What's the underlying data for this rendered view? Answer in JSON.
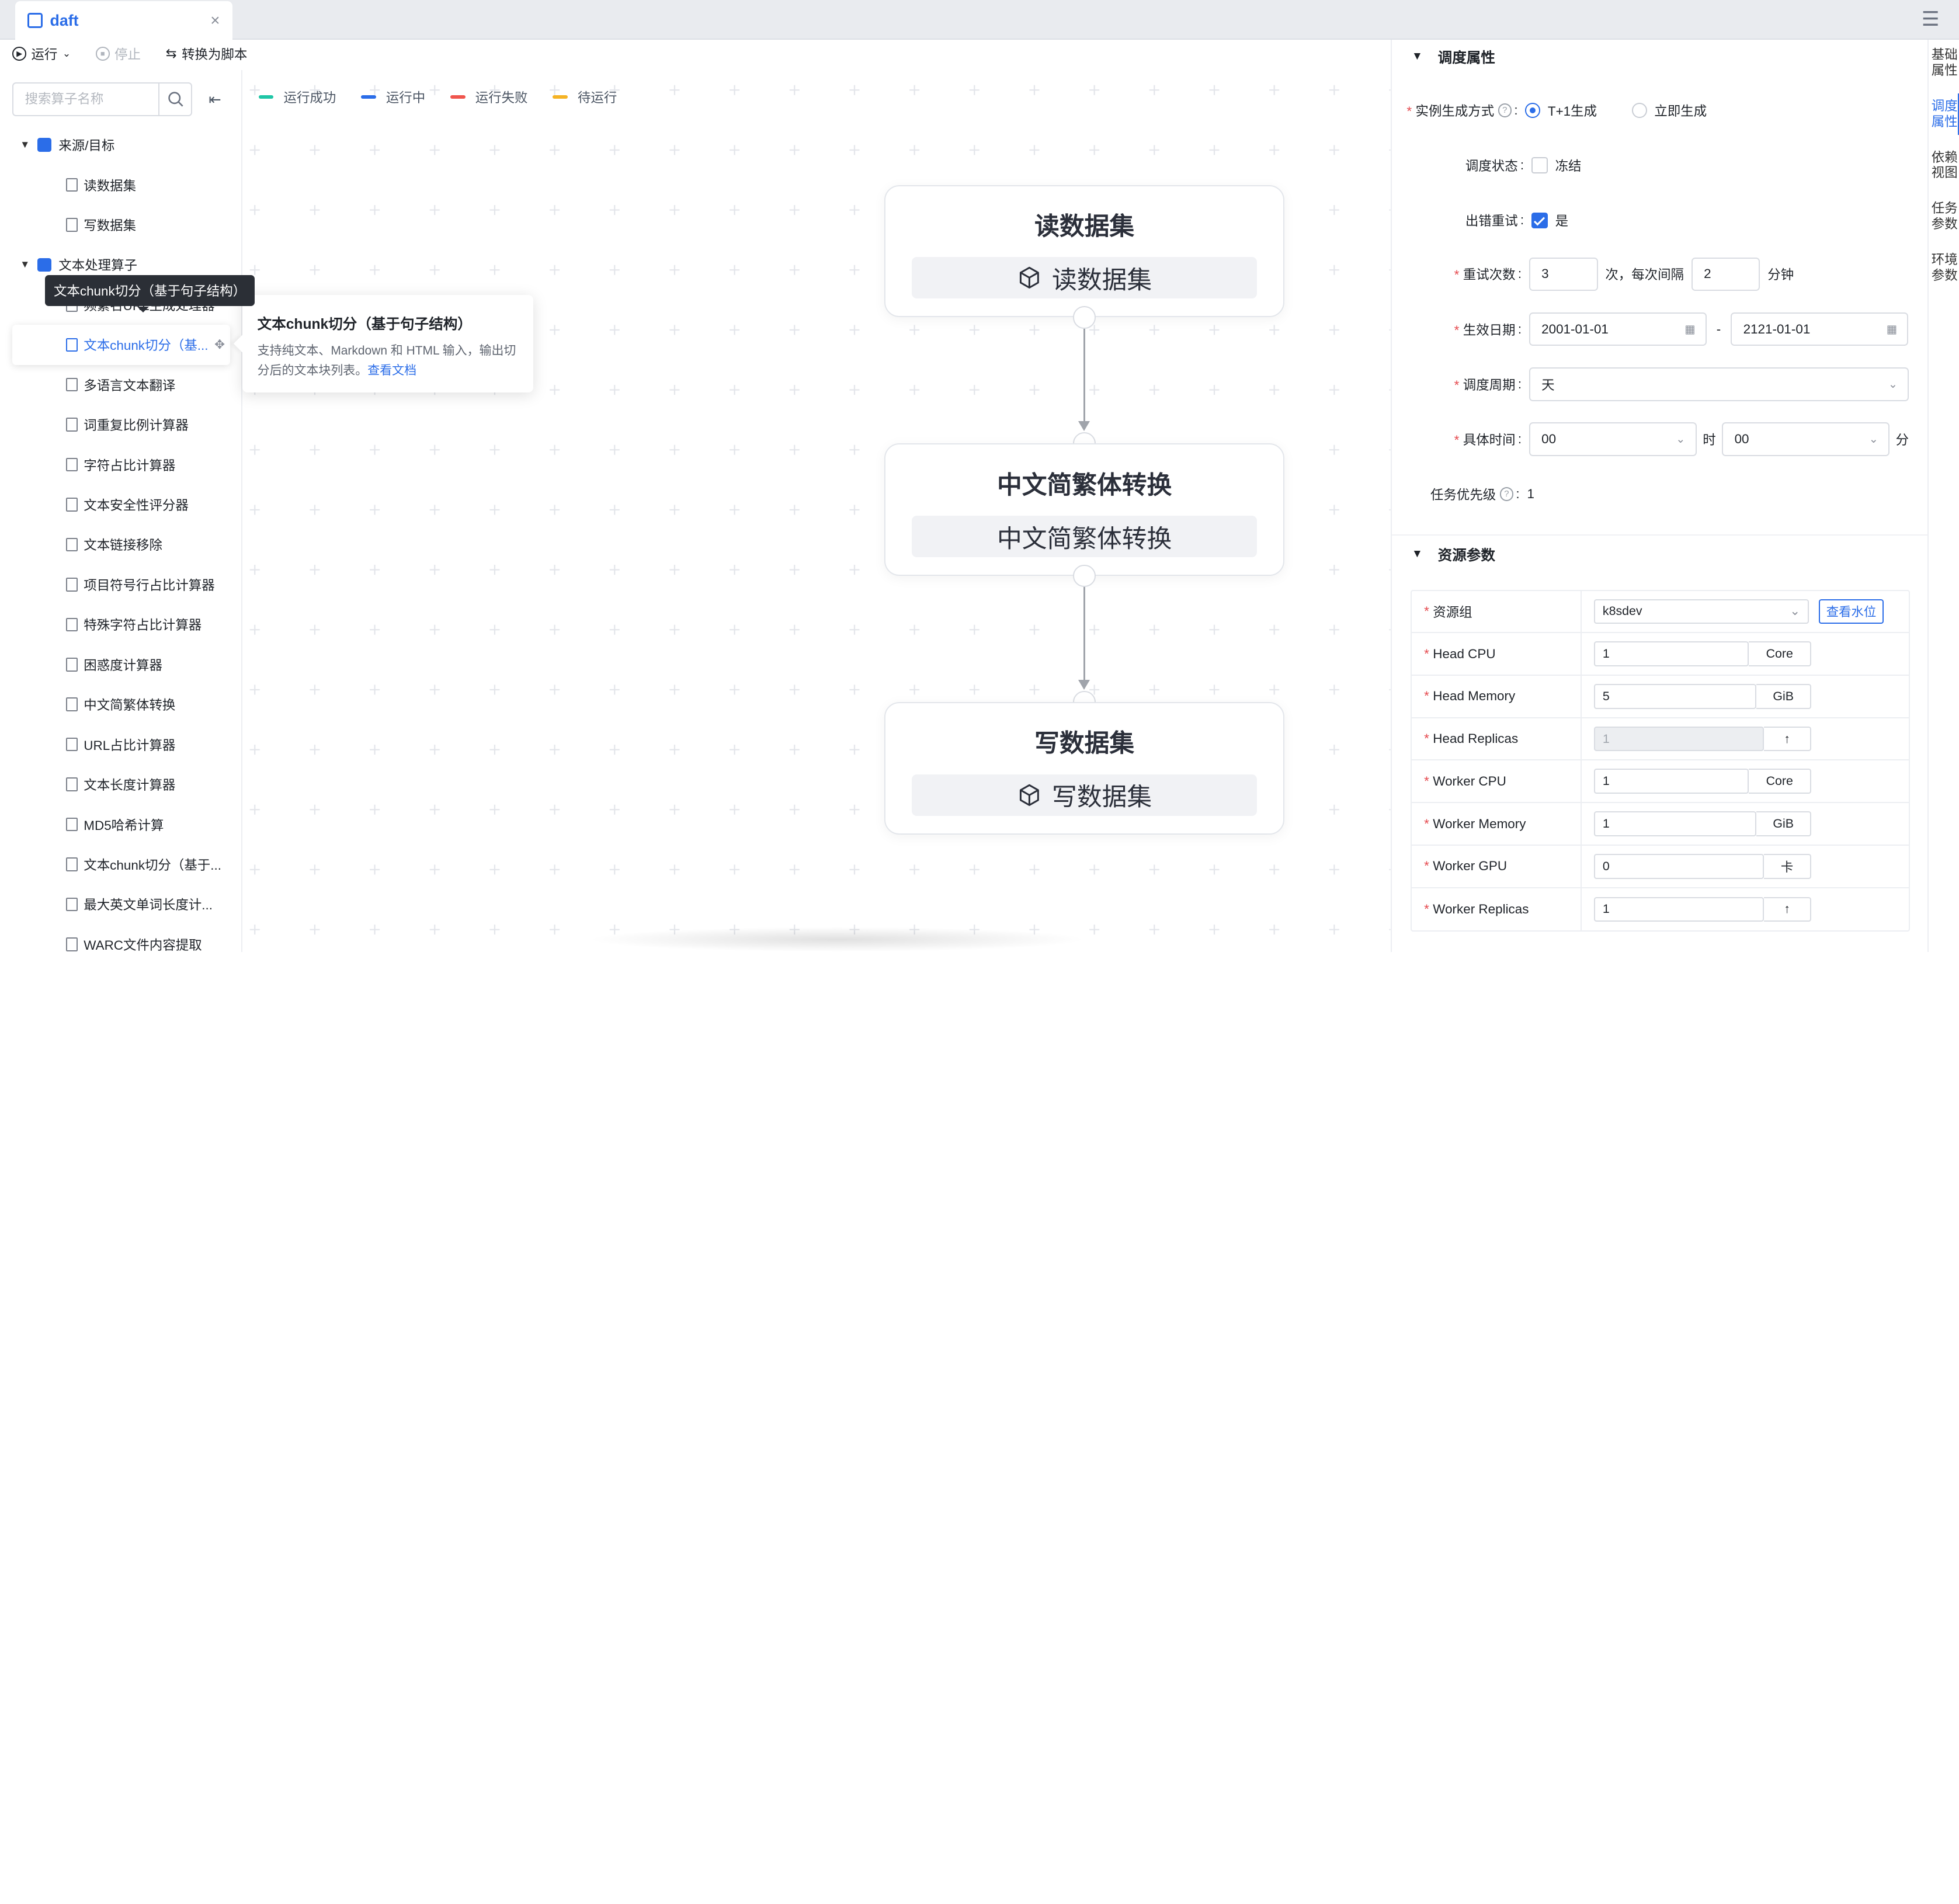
{
  "tab": {
    "title": "daft",
    "close": "×"
  },
  "toolbar": {
    "run": "运行",
    "stop": "停止",
    "convert": "转换为脚本"
  },
  "left": {
    "search_placeholder": "搜索算子名称",
    "groups": [
      {
        "label": "来源/目标",
        "items": [
          "读数据集",
          "写数据集"
        ]
      },
      {
        "label": "文本处理算子",
        "items": [
          "频繁名URL生成处理器",
          "文本chunk切分（基...",
          "多语言文本翻译",
          "词重复比例计算器",
          "字符占比计算器",
          "文本安全性评分器",
          "文本链接移除",
          "项目符号行占比计算器",
          "特殊字符占比计算器",
          "困惑度计算器",
          "中文简繁体转换",
          "URL占比计算器",
          "文本长度计算器",
          "MD5哈希计算",
          "文本chunk切分（基于...",
          "最大英文单词长度计...",
          "WARC文件内容提取"
        ]
      }
    ],
    "tooltip": "文本chunk切分（基于句子结构）",
    "popover": {
      "title": "文本chunk切分（基于句子结构）",
      "desc": "支持纯文本、Markdown 和 HTML 输入，输出切分后的文本块列表。",
      "link": "查看文档"
    }
  },
  "legend": [
    {
      "label": "运行成功",
      "color": "#1fc6a6"
    },
    {
      "label": "运行中",
      "color": "#2b6de8"
    },
    {
      "label": "运行失败",
      "color": "#f0554d"
    },
    {
      "label": "待运行",
      "color": "#f5b324"
    }
  ],
  "nodes": [
    {
      "title": "读数据集",
      "body": "读数据集",
      "icon": "cube-icon"
    },
    {
      "title": "中文简繁体转换",
      "body": "中文简繁体转换"
    },
    {
      "title": "写数据集",
      "body": "写数据集",
      "icon": "cube-icon"
    }
  ],
  "schedule": {
    "section": "调度属性",
    "instance_label": "实例生成方式",
    "instance_opt1": "T+1生成",
    "instance_opt2": "立即生成",
    "status_label": "调度状态",
    "status_opt": "冻结",
    "retry_label": "出错重试",
    "retry_opt": "是",
    "retry_count_label": "重试次数",
    "retry_count": "3",
    "retry_mid": "次，每次间隔",
    "retry_interval": "2",
    "retry_unit": "分钟",
    "date_label": "生效日期",
    "date_start": "2001-01-01",
    "date_sep": "-",
    "date_end": "2121-01-01",
    "period_label": "调度周期",
    "period": "天",
    "time_label": "具体时间",
    "hour": "00",
    "hour_unit": "时",
    "minute": "00",
    "minute_unit": "分",
    "priority_label": "任务优先级",
    "priority": "1"
  },
  "resources": {
    "section": "资源参数",
    "group_label": "资源组",
    "group": "k8sdev",
    "watermark_btn": "查看水位",
    "rows": [
      {
        "label": "Head CPU",
        "value": "1",
        "unit": "Core"
      },
      {
        "label": "Head Memory",
        "value": "5",
        "unit": "GiB"
      },
      {
        "label": "Head Replicas",
        "value": "1",
        "unit": "↑"
      },
      {
        "label": "Worker CPU",
        "value": "1",
        "unit": "Core"
      },
      {
        "label": "Worker Memory",
        "value": "1",
        "unit": "GiB"
      },
      {
        "label": "Worker GPU",
        "value": "0",
        "unit": "卡"
      },
      {
        "label": "Worker Replicas",
        "value": "1",
        "unit": "↑"
      }
    ]
  },
  "vtabs": [
    "基础属性",
    "调度属性",
    "依赖视图",
    "任务参数",
    "环境参数"
  ]
}
